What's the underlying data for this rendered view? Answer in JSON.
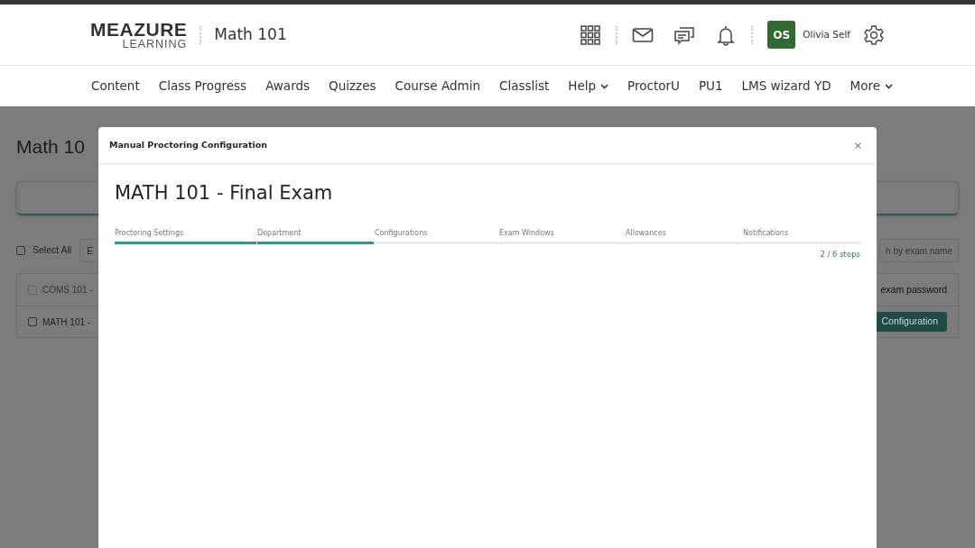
{
  "header": {
    "logo_top": "MEAZURE",
    "logo_bottom": "LEARNING",
    "course_title": "Math 101",
    "user": {
      "initials": "OS",
      "name": "Olivia Self"
    }
  },
  "nav": [
    {
      "label": "Content",
      "dropdown": false
    },
    {
      "label": "Class Progress",
      "dropdown": false
    },
    {
      "label": "Awards",
      "dropdown": false
    },
    {
      "label": "Quizzes",
      "dropdown": false
    },
    {
      "label": "Course Admin",
      "dropdown": false
    },
    {
      "label": "Classlist",
      "dropdown": false
    },
    {
      "label": "Help",
      "dropdown": true
    },
    {
      "label": "ProctorU",
      "dropdown": false
    },
    {
      "label": "PU1",
      "dropdown": false
    },
    {
      "label": "LMS wizard YD",
      "dropdown": false
    },
    {
      "label": "More",
      "dropdown": true
    }
  ],
  "page": {
    "title": "Math 10",
    "select_all": {
      "label": "Select All",
      "checked": false
    },
    "filter_value": "E",
    "search_placeholder": "h by exam name",
    "rows": [
      {
        "name": "COMS 101 - ",
        "checked": false,
        "disabled": true,
        "action_text": "exam password"
      },
      {
        "name": "MATH 101 - ",
        "checked": false,
        "disabled": false,
        "button": "Configuration"
      }
    ]
  },
  "modal": {
    "title": "Manual Proctoring Configuration",
    "close": "×",
    "heading": "MATH 101 - Final Exam",
    "steps": [
      {
        "label": "Proctoring Settings",
        "completed": true
      },
      {
        "label": "Department",
        "completed": true
      },
      {
        "label": "Configurations",
        "completed": false
      },
      {
        "label": "Exam Windows",
        "completed": false
      },
      {
        "label": "Allowances",
        "completed": false
      },
      {
        "label": "Notifications",
        "completed": false
      }
    ],
    "progress_text": "2 / 6 steps"
  }
}
